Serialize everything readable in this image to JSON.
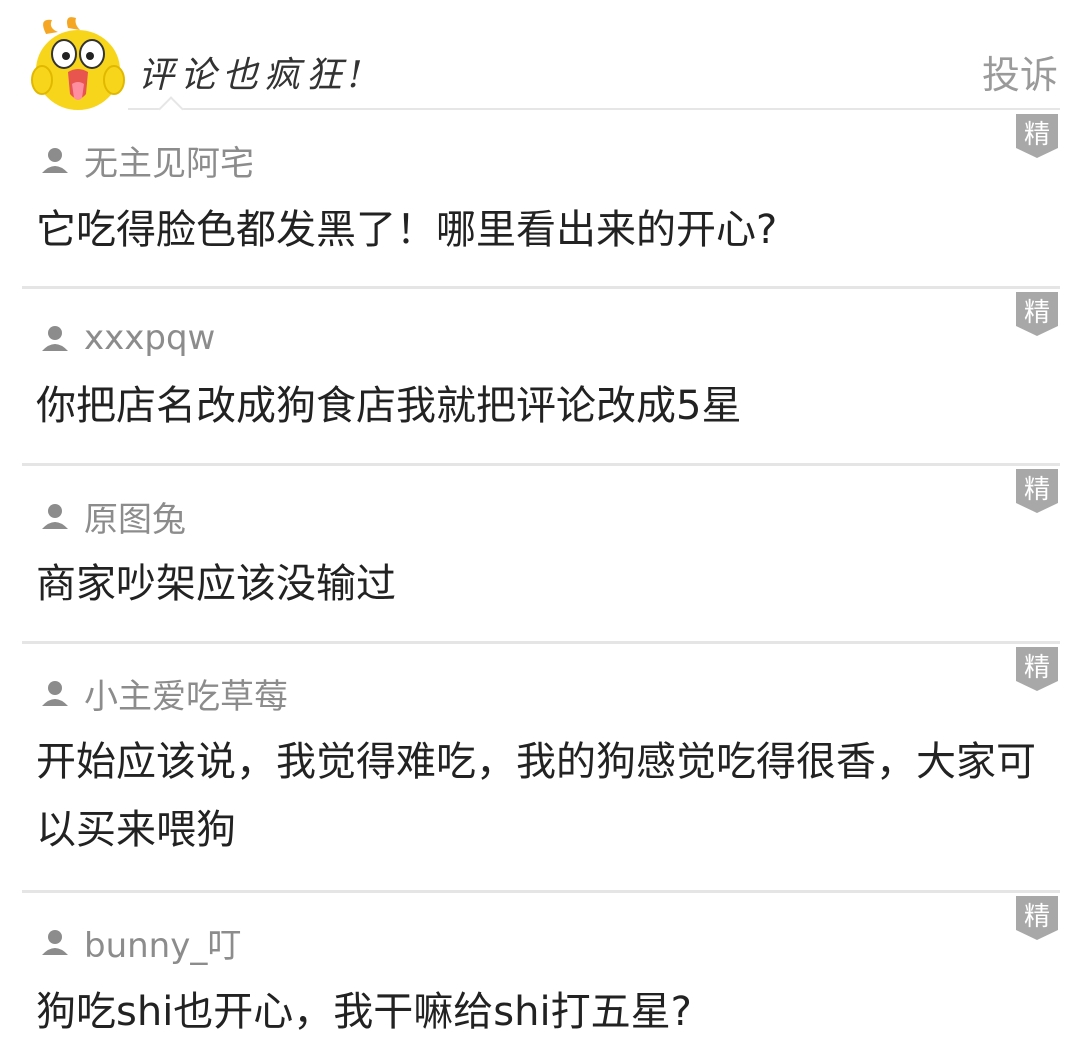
{
  "header": {
    "title": "评论也疯狂!",
    "report_label": "投诉"
  },
  "badge_label": "精",
  "comments": [
    {
      "user": "无主见阿宅",
      "text": "它吃得脸色都发黑了！哪里看出来的开心?"
    },
    {
      "user": "xxxpqw",
      "text": "你把店名改成狗食店我就把评论改成5星"
    },
    {
      "user": "原图兔",
      "text": "商家吵架应该没输过"
    },
    {
      "user": "小主爱吃草莓",
      "text": "开始应该说，我觉得难吃，我的狗感觉吃得很香，大家可以买来喂狗"
    },
    {
      "user": "bunny_叮",
      "text": "狗吃shi也开心，我干嘛给shi打五星?"
    }
  ],
  "colors": {
    "mascot": "#f7d51a",
    "badge": "#a8a8a8",
    "divider": "#e5e5e5"
  },
  "icons": [
    "mascot-icon",
    "user-icon",
    "featured-badge"
  ]
}
